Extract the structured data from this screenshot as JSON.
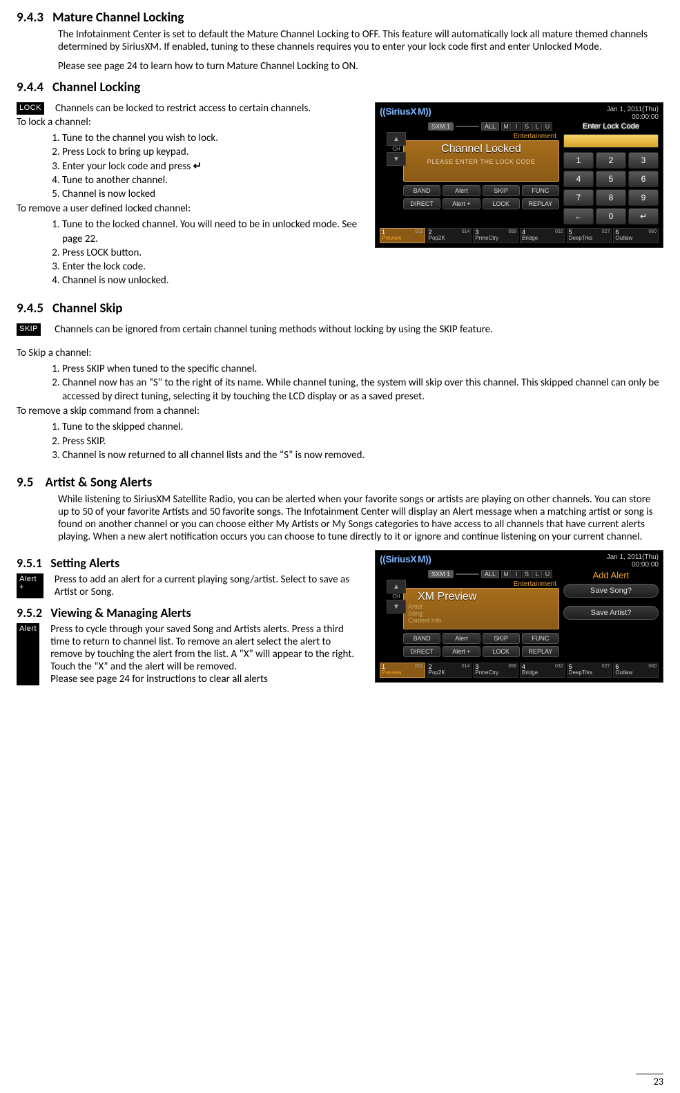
{
  "sec943": {
    "num": "9.4.3",
    "title": "Mature Channel Locking",
    "p1": "The Infotainment Center is set to default the Mature Channel Locking to OFF. This feature will automatically lock all mature themed channels determined by SiriusXM. If enabled, tuning to these channels requires you to enter your lock code first and enter Unlocked Mode.",
    "p2": "Please see page 24 to learn how to turn Mature Channel Locking to ON."
  },
  "sec944": {
    "num": "9.4.4",
    "title": "Channel Locking",
    "icon": "LOCK",
    "intro": "Channels can be locked to restrict access to certain channels.",
    "lock_head": "To lock a channel:",
    "lock_steps": [
      "Tune to the channel you wish to lock.",
      "Press Lock to bring up keypad.",
      "Enter your lock code and press",
      "Tune to another channel.",
      "Channel is now locked"
    ],
    "remove_head": "To remove a user defined locked channel:",
    "remove_steps": [
      "Tune to the locked channel. You will need to be in unlocked mode. See page 22.",
      "Press LOCK button.",
      "Enter the lock code.",
      "Channel is now unlocked."
    ]
  },
  "sec945": {
    "num": "9.4.5",
    "title": "Channel Skip",
    "icon": "SKIP",
    "intro": "Channels can be ignored from certain channel tuning methods without locking by using the SKIP feature.",
    "skip_head": "To Skip a channel:",
    "skip_steps": [
      "Press SKIP when tuned to the specific channel.",
      "Channel now has an “S” to the right of its name. While channel tuning, the system will skip over this channel. This skipped channel can only be accessed by direct tuning, selecting it by touching the LCD display or as a saved preset."
    ],
    "unskip_head": "To remove a skip command from a channel:",
    "unskip_steps": [
      "Tune to the skipped channel.",
      "Press SKIP.",
      "Channel is now returned to all channel lists and the “S” is now removed."
    ]
  },
  "sec95": {
    "num": "9.5",
    "title": "Artist & Song  Alerts",
    "body": "While listening to SiriusXM Satellite Radio, you can be alerted when your favorite songs or artists are playing on other channels. You can store up to 50 of your favorite Artists and 50 favorite songs. The Infotainment Center will display an Alert message when a matching artist or song is found on another channel or you can choose either My Artists or My Songs categories to have access to all channels that have current alerts playing. When a new alert notification occurs you can choose to tune directly to it or ignore and continue listening on your current channel."
  },
  "sec951": {
    "num": "9.5.1",
    "title": "Setting Alerts",
    "icon": "Alert +",
    "body": "Press to add an alert for a current playing song/artist. Select to save as Artist or Song."
  },
  "sec952": {
    "num": "9.5.2",
    "title": "Viewing & Managing Alerts",
    "icon": "Alert",
    "body": "Press to cycle through your saved Song and Artists alerts. Press a third time to return to channel list. To remove an alert select the alert to remove by touching the alert from the list. A “X” will appear to the right. Touch the “X” and the alert will be removed.",
    "body2": "Please see page 24 for instructions to clear all alerts"
  },
  "sxm": {
    "logo": "((SiriusX M))",
    "date": "Jan 1, 2011(Thu)",
    "time": "00:00:00",
    "tags": {
      "sxm1": "SXM 1",
      "all": "ALL",
      "letters": [
        "M",
        "I",
        "S",
        "L",
        "U"
      ],
      "cat": "Entertainment"
    },
    "panel_lock": {
      "title": "Channel Locked",
      "sub": "PLEASE ENTER THE LOCK CODE"
    },
    "panel_preview": {
      "title": "XM Preview",
      "l1": "Artist",
      "l2": "Song",
      "l3": "Content info"
    },
    "ch_up": "▲",
    "ch_dn": "▼",
    "ch_lbl": "CH",
    "row1": [
      "BAND",
      "Alert",
      "SKIP",
      "FUNC"
    ],
    "row2": [
      "DIRECT",
      "Alert +",
      "LOCK",
      "REPLAY"
    ],
    "entry_head": "Enter Lock Code",
    "alert_head": "Add Alert",
    "save_song": "Save Song?",
    "save_artist": "Save Artist?",
    "keys": [
      "1",
      "2",
      "3",
      "4",
      "5",
      "6",
      "7",
      "8",
      "9",
      "←",
      "0",
      "↵"
    ],
    "presets": [
      {
        "n": "1",
        "ch": "001",
        "name": "Preview"
      },
      {
        "n": "2",
        "ch": "014",
        "name": "Pop2K"
      },
      {
        "n": "3",
        "ch": "058",
        "name": "PrmeCtry"
      },
      {
        "n": "4",
        "ch": "032",
        "name": "Bridge"
      },
      {
        "n": "5",
        "ch": "027",
        "name": "DeepTrks"
      },
      {
        "n": "6",
        "ch": "060",
        "name": "Outlaw"
      }
    ]
  },
  "page_number": "23"
}
